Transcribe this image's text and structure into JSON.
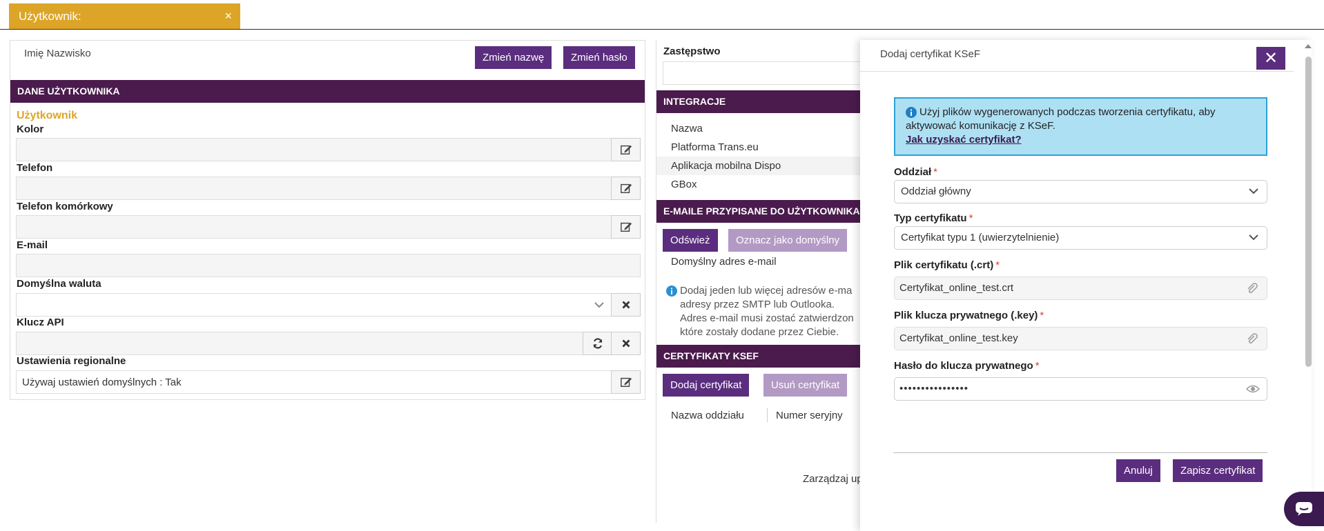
{
  "tab": {
    "title": "Użytkownik:",
    "close": "×"
  },
  "left": {
    "full_name": "Imię Nazwisko",
    "rename_btn": "Zmień nazwę",
    "change_password_btn": "Zmień hasło",
    "section_title": "DANE UŻYTKOWNIKA",
    "user_label": "Użytkownik",
    "color_label": "Kolor",
    "phone_label": "Telefon",
    "mobile_label": "Telefon komórkowy",
    "email_label": "E-mail",
    "currency_label": "Domyślna waluta",
    "api_key_label": "Klucz API",
    "regional_label": "Ustawienia regionalne",
    "regional_value": "Używaj ustawień domyślnych : Tak"
  },
  "middle": {
    "substitute_label": "Zastępstwo",
    "integrations_title": "INTEGRACJE",
    "integrations_header": "Nazwa",
    "integrations": [
      "Platforma Trans.eu",
      "Aplikacja mobilna Dispo",
      "GBox"
    ],
    "emails_title": "E-MAILE PRZYPISANE DO UŻYTKOWNIKA",
    "refresh_btn": "Odśwież",
    "set_default_btn": "Oznacz jako domyślny",
    "default_email_header": "Domyślny adres e-mail",
    "email_info": [
      "Dodaj jeden lub więcej adresów e-ma",
      "adresy przez SMTP lub Outlooka.",
      "Adres e-mail musi zostać zatwierdzon",
      "które zostały dodane przez Ciebie."
    ],
    "ksef_title": "CERTYFIKATY KSEF",
    "add_cert_btn": "Dodaj certyfikat",
    "remove_cert_btn": "Usuń certyfikat",
    "col_branch": "Nazwa oddziału",
    "col_serial": "Numer seryjny",
    "manage_text": "Zarządzaj up"
  },
  "modal": {
    "title": "Dodaj certyfikat KSeF",
    "close": "✕",
    "info_text": "Użyj plików wygenerowanych podczas tworzenia certyfikatu, aby aktywować komunikację z KSeF.",
    "info_link": "Jak uzyskać certyfikat?",
    "branch_label": "Oddział",
    "branch_value": "Oddział główny",
    "cert_type_label": "Typ certyfikatu",
    "cert_type_value": "Certyfikat typu 1 (uwierzytelnienie)",
    "cert_file_label": "Plik certyfikatu (.crt)",
    "cert_file_value": "Certyfikat_online_test.crt",
    "key_file_label": "Plik klucza prywatnego (.key)",
    "key_file_value": "Certyfikat_online_test.key",
    "password_label": "Hasło do klucza prywatnego",
    "password_value": "••••••••••••••••",
    "required_mark": "*",
    "cancel_btn": "Anuluj",
    "save_btn": "Zapisz certyfikat"
  },
  "colors": {
    "accent": "#5b2d7e",
    "header": "#4a1b4c",
    "tab": "#dca528",
    "info_bg": "#aee0f3"
  }
}
